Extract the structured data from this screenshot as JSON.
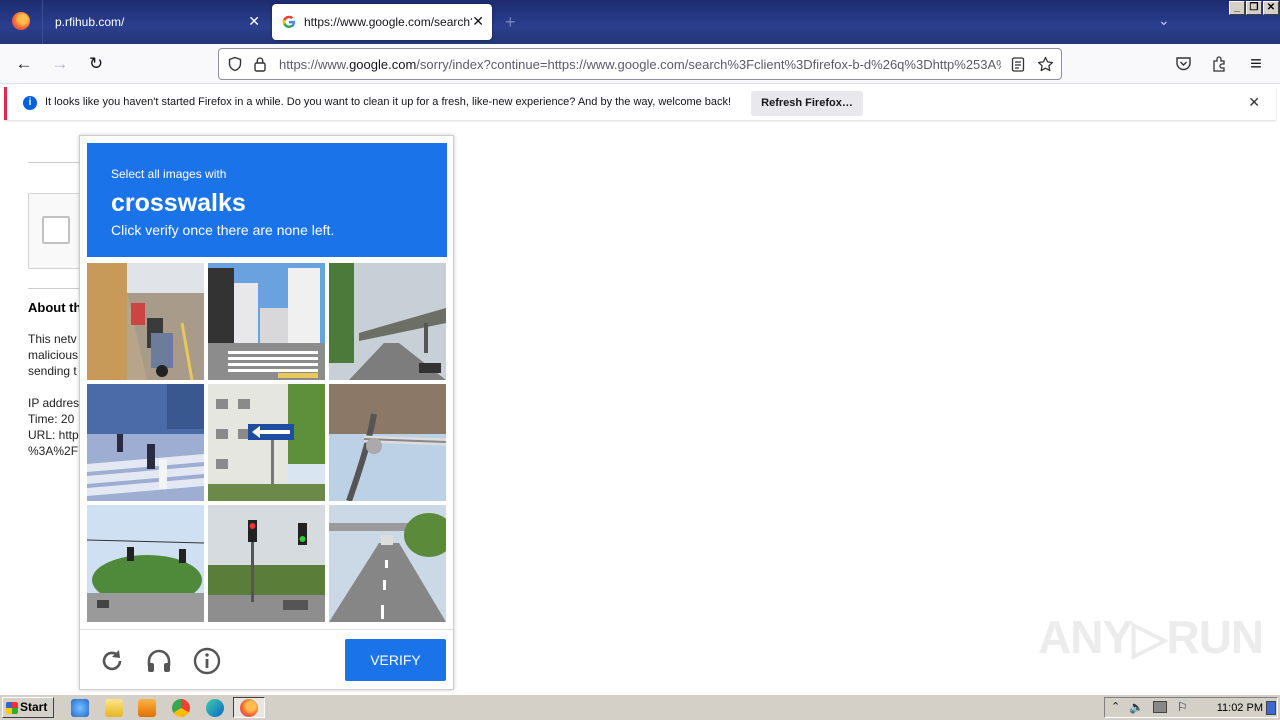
{
  "browser": {
    "tabs": [
      {
        "label": "p.rfihub.com/",
        "active": false
      },
      {
        "label": "https://www.google.com/search?client=",
        "active": true
      }
    ],
    "new_tab_glyph": "+",
    "tab_list_glyph": "⌄",
    "window_buttons": [
      "_",
      "❐",
      "✕"
    ],
    "url": {
      "prefix": "https://www.",
      "domain": "google.com",
      "rest": "/sorry/index?continue=https://www.google.com/search%3Fclient%3Dfirefox-b-d%26q%3Dhttp%253A%252F%252F"
    },
    "nav_glyphs": {
      "back": "←",
      "forward": "→",
      "reload": "↻",
      "menu": "≡"
    }
  },
  "notification": {
    "info_glyph": "i",
    "text": "It looks like you haven't started Firefox in a while. Do you want to clean it up for a fresh, like-new experience? And by the way, welcome back!",
    "button": "Refresh Firefox…",
    "close_glyph": "✕"
  },
  "page": {
    "about_heading": "About th",
    "lines": [
      "This netv",
      "malicious",
      "sending t",
      "",
      "IP addres",
      "Time: 20",
      "URL: http",
      "%3A%2F"
    ]
  },
  "captcha": {
    "instruction_top": "Select all images with",
    "target_word": "crosswalks",
    "instruction_bottom": "Click verify once there are none left.",
    "verify_label": "VERIFY",
    "tiles": [
      "scooter-street",
      "building-crosswalk",
      "overpass-road",
      "people-crosswalk",
      "one-way-sign-building",
      "metal-pole-closeup",
      "traffic-light-trees",
      "traffic-lights-intersection",
      "highway-overpass"
    ]
  },
  "watermark": "ANY▷RUN",
  "taskbar": {
    "start_label": "Start",
    "clock": "11:02 PM",
    "apps": [
      "ie-icon",
      "explorer-icon",
      "media-icon",
      "chrome-icon",
      "edge-icon",
      "firefox-icon"
    ]
  },
  "colors": {
    "captcha_blue": "#1a73e8",
    "titlebar": "#2b3f8f",
    "notification_accent": "#e22850"
  }
}
